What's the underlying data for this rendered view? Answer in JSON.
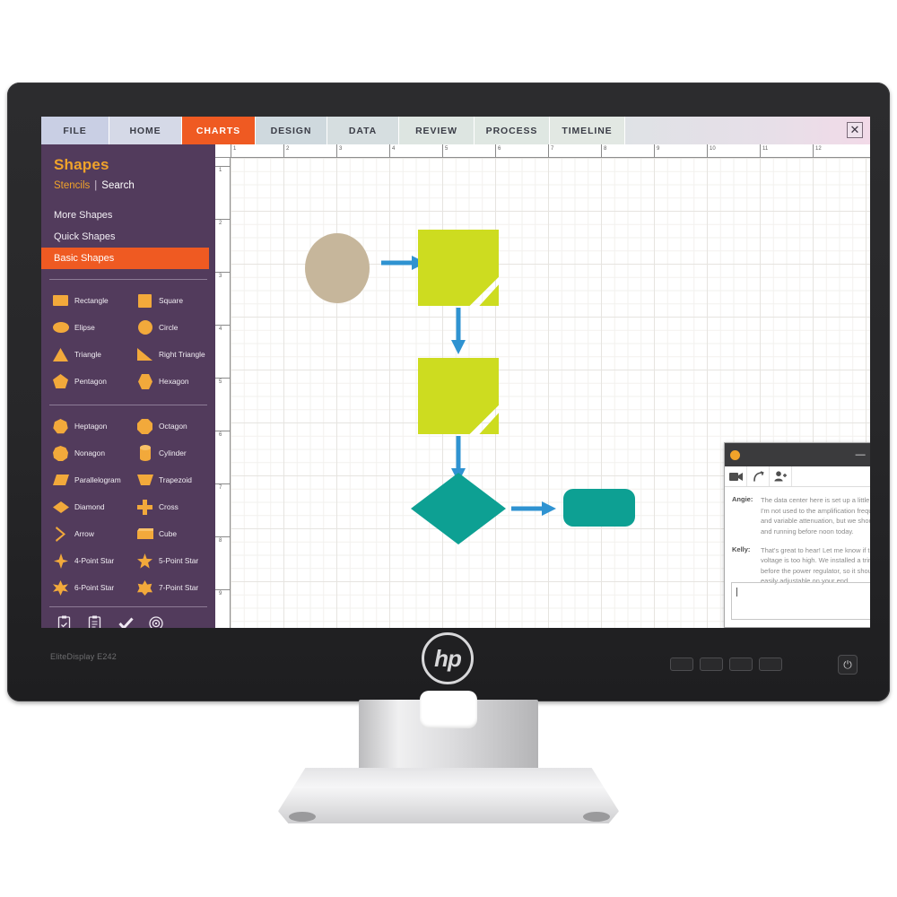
{
  "monitor": {
    "model_label": "EliteDisplay E242",
    "brand": "hp",
    "power_icon": "power-icon"
  },
  "app": {
    "tabs": [
      {
        "label": "FILE",
        "active": false
      },
      {
        "label": "HOME",
        "active": false
      },
      {
        "label": "CHARTS",
        "active": true
      },
      {
        "label": "DESIGN",
        "active": false
      },
      {
        "label": "DATA",
        "active": false
      },
      {
        "label": "REVIEW",
        "active": false
      },
      {
        "label": "PROCESS",
        "active": false
      },
      {
        "label": "TIMELINE",
        "active": false
      }
    ],
    "close_label": "✕",
    "accent_orange": "#ef5a22",
    "sidebar_purple": "#523b5c"
  },
  "sidebar": {
    "title": "Shapes",
    "links": {
      "stencils": "Stencils",
      "separator": "|",
      "search": "Search"
    },
    "nav": [
      {
        "label": "More Shapes",
        "active": false
      },
      {
        "label": "Quick Shapes",
        "active": false
      },
      {
        "label": "Basic Shapes",
        "active": true
      }
    ],
    "shapes_group_1": [
      {
        "label": "Rectangle",
        "icon": "rectangle-icon"
      },
      {
        "label": "Square",
        "icon": "square-icon"
      },
      {
        "label": "Elipse",
        "icon": "ellipse-icon"
      },
      {
        "label": "Circle",
        "icon": "circle-icon"
      },
      {
        "label": "Triangle",
        "icon": "triangle-icon"
      },
      {
        "label": "Right Triangle",
        "icon": "right-triangle-icon"
      },
      {
        "label": "Pentagon",
        "icon": "pentagon-icon"
      },
      {
        "label": "Hexagon",
        "icon": "hexagon-icon"
      }
    ],
    "shapes_group_2": [
      {
        "label": "Heptagon",
        "icon": "heptagon-icon"
      },
      {
        "label": "Octagon",
        "icon": "octagon-icon"
      },
      {
        "label": "Nonagon",
        "icon": "nonagon-icon"
      },
      {
        "label": "Cylinder",
        "icon": "cylinder-icon"
      },
      {
        "label": "Parallelogram",
        "icon": "parallelogram-icon"
      },
      {
        "label": "Trapezoid",
        "icon": "trapezoid-icon"
      },
      {
        "label": "Diamond",
        "icon": "diamond-icon"
      },
      {
        "label": "Cross",
        "icon": "cross-icon"
      },
      {
        "label": "Arrow",
        "icon": "arrow-icon"
      },
      {
        "label": "Cube",
        "icon": "cube-icon"
      },
      {
        "label": "4-Point Star",
        "icon": "star-4-icon"
      },
      {
        "label": "5-Point Star",
        "icon": "star-5-icon"
      },
      {
        "label": "6-Point Star",
        "icon": "star-6-icon"
      },
      {
        "label": "7-Point Star",
        "icon": "star-7-icon"
      }
    ],
    "tools": [
      {
        "icon": "clipboard-check-icon"
      },
      {
        "icon": "clipboard-icon"
      },
      {
        "icon": "checkmark-icon"
      },
      {
        "icon": "target-icon"
      }
    ],
    "shape_color": "#f2a93b"
  },
  "canvas": {
    "ruler_h": [
      "1",
      "2",
      "3",
      "4",
      "5",
      "6",
      "7",
      "8",
      "9",
      "10",
      "11",
      "12"
    ],
    "ruler_v": [
      "1",
      "2",
      "3",
      "4",
      "5",
      "6",
      "7",
      "8",
      "9"
    ],
    "diagram": {
      "nodes": [
        {
          "name": "start-ellipse",
          "shape": "ellipse",
          "color": "#c6b69b"
        },
        {
          "name": "process-box-1",
          "shape": "folded-square",
          "color": "#cddc20"
        },
        {
          "name": "process-box-2",
          "shape": "folded-square",
          "color": "#cddc20"
        },
        {
          "name": "decision-diamond",
          "shape": "diamond",
          "color": "#0da093"
        },
        {
          "name": "end-rounded-rect",
          "shape": "rounded-rect",
          "color": "#0da093"
        }
      ],
      "connectors": [
        {
          "name": "connector-1",
          "direction": "right"
        },
        {
          "name": "connector-2",
          "direction": "down"
        },
        {
          "name": "connector-3",
          "direction": "down"
        },
        {
          "name": "connector-4",
          "direction": "right"
        }
      ],
      "connector_color": "#2f93d1"
    }
  },
  "chat": {
    "window_controls": {
      "minimize": "—",
      "expand": "↗",
      "close": "✕"
    },
    "toolbar": [
      {
        "icon": "video-camera-icon"
      },
      {
        "icon": "phone-call-icon"
      },
      {
        "icon": "add-person-icon"
      },
      {
        "icon": "filter-icon"
      }
    ],
    "messages": [
      {
        "sender": "Angie:",
        "text": "The data center here is set up a little different. I'm not used to the amplification frequencies and variable attenuation, but we should be up and running before noon today."
      },
      {
        "sender": "Kelly:",
        "text": "That's great to hear! Let me know if the plate voltage is too high. We installed a trimpot before the power regulator, so it should be easily adjustable on your end."
      }
    ],
    "input_value": "",
    "input_placeholder": "",
    "emoji_icon": "smiley-icon"
  }
}
